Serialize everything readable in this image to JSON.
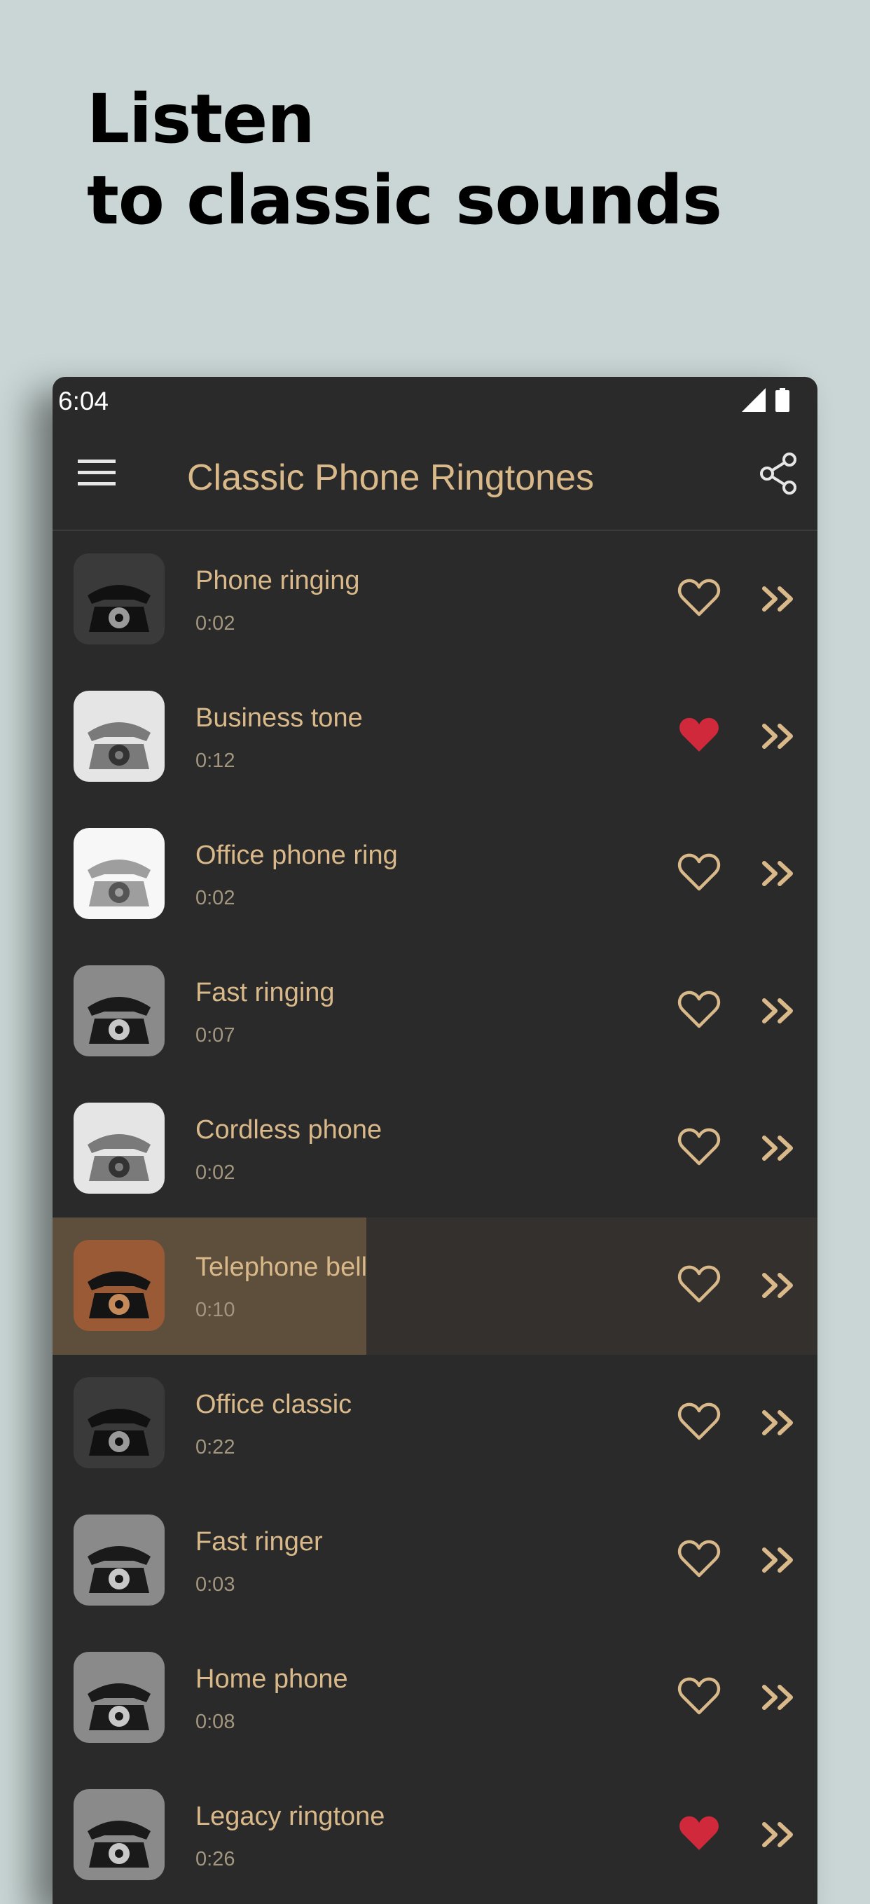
{
  "promo": {
    "line1": "Listen",
    "line2": "to classic sounds"
  },
  "statusbar": {
    "time": "6:04",
    "icons": [
      "signal-icon",
      "battery-icon"
    ]
  },
  "appbar": {
    "title": "Classic Phone Ringtones",
    "menu_icon": "hamburger-menu-icon",
    "share_icon": "share-icon"
  },
  "colors": {
    "background": "#c9d6d5",
    "surface": "#2a2a2a",
    "accent": "#d9b98a",
    "favorite": "#d0293b",
    "progress": "#5e4e3c"
  },
  "ringtones": [
    {
      "name": "Phone ringing",
      "duration": "0:02",
      "favorite": false,
      "thumb": "dark"
    },
    {
      "name": "Business tone",
      "duration": "0:12",
      "favorite": true,
      "thumb": "light"
    },
    {
      "name": "Office phone ring",
      "duration": "0:02",
      "favorite": false,
      "thumb": "white"
    },
    {
      "name": "Fast ringing",
      "duration": "0:07",
      "favorite": false,
      "thumb": "mid"
    },
    {
      "name": "Cordless phone",
      "duration": "0:02",
      "favorite": false,
      "thumb": "light"
    },
    {
      "name": "Telephone bell",
      "duration": "0:10",
      "favorite": false,
      "thumb": "warm",
      "playing": true,
      "progress": 0.41
    },
    {
      "name": "Office classic",
      "duration": "0:22",
      "favorite": false,
      "thumb": "dark"
    },
    {
      "name": "Fast ringer",
      "duration": "0:03",
      "favorite": false,
      "thumb": "mid"
    },
    {
      "name": "Home phone",
      "duration": "0:08",
      "favorite": false,
      "thumb": "mid"
    },
    {
      "name": "Legacy ringtone",
      "duration": "0:26",
      "favorite": true,
      "thumb": "mid"
    }
  ]
}
